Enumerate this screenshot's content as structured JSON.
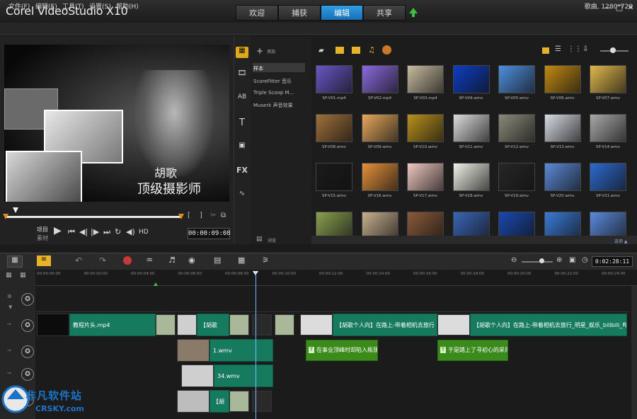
{
  "app": {
    "logo": "Corel VideoStudio X10"
  },
  "tabs": [
    {
      "label": "欢迎"
    },
    {
      "label": "捕获"
    },
    {
      "label": "编辑"
    },
    {
      "label": "共享"
    }
  ],
  "menu": {
    "items": [
      "文件(F)",
      "编辑(E)",
      "工具(T)",
      "设置(S)",
      "帮助(H)"
    ],
    "project_info": "歌曲, 1280*720"
  },
  "player": {
    "overlay_line1": "胡歌",
    "overlay_line2": "顶级摄影师",
    "mode_project": "项目",
    "mode_clip": "素材",
    "hd": "HD",
    "timecode": "00:00:09:08"
  },
  "library": {
    "add_label": "添加",
    "browse_label": "浏览",
    "folders": [
      "样本",
      "ScoreFitter 音乐",
      "Triple Scoop M...",
      "Muserk 声音效果"
    ],
    "thumbs": [
      {
        "label": "SP-V01.mp4",
        "color": "#6a56c8"
      },
      {
        "label": "SP-V02.mp4",
        "color": "#8a6adf"
      },
      {
        "label": "SP-V03.mp4",
        "color": "#c8bca0"
      },
      {
        "label": "SP-V04.wmv",
        "color": "#0c3ec4"
      },
      {
        "label": "SP-V05.wmv",
        "color": "#4f8fe0"
      },
      {
        "label": "SP-V06.wmv",
        "color": "#c28a14"
      },
      {
        "label": "SP-V07.wmv",
        "color": "#e2b84c"
      },
      {
        "label": "SP-V08.wmv",
        "color": "#a0703a"
      },
      {
        "label": "SP-V09.wmv",
        "color": "#e6a85c"
      },
      {
        "label": "SP-V10.wmv",
        "color": "#b8901c"
      },
      {
        "label": "SP-V11.wmv",
        "color": "#dcdcdc"
      },
      {
        "label": "SP-V12.wmv",
        "color": "#8a8a7a"
      },
      {
        "label": "SP-V13.wmv",
        "color": "#d8dce4"
      },
      {
        "label": "SP-V14.wmv",
        "color": "#a8a8a8"
      },
      {
        "label": "SP-V15.wmv",
        "color": "#1a1a1a"
      },
      {
        "label": "SP-V16.wmv",
        "color": "#e6903a"
      },
      {
        "label": "SP-V17.wmv",
        "color": "#f0c8c0"
      },
      {
        "label": "SP-V18.wmv",
        "color": "#f2f2ea"
      },
      {
        "label": "SP-V19.wmv",
        "color": "#262626"
      },
      {
        "label": "SP-V20.wmv",
        "color": "#5a8ad8"
      },
      {
        "label": "SP-V21.wmv",
        "color": "#2e6ad0"
      },
      {
        "label": "",
        "color": "#8aa050"
      },
      {
        "label": "",
        "color": "#c8b090"
      },
      {
        "label": "",
        "color": "#8a5a3a"
      },
      {
        "label": "",
        "color": "#3a66b8"
      },
      {
        "label": "",
        "color": "#1a48b0"
      },
      {
        "label": "",
        "color": "#3a7ad8"
      },
      {
        "label": "",
        "color": "#5a8adc"
      }
    ]
  },
  "timeline": {
    "timecode": "0:02:28:11",
    "ruler": [
      "00:00:00:00",
      "00:00:02:00",
      "00:00:04:00",
      "00:00:06:00",
      "00:00:08:00",
      "00:00:10:00",
      "00:00:12:00",
      "00:00:14:00",
      "00:00:16:00",
      "00:00:18:00",
      "00:00:20:00",
      "00:00:22:00",
      "00:00:24:00"
    ],
    "clips": {
      "video_main": "教程片头.mp4",
      "video_hu": "【胡歌",
      "video_long1": "【胡歌个人向】在路上-带着相机去旅行",
      "video_long2": "【胡歌个人向】在路上-带着相机去旅行_明星_娱乐_bilibili_哔",
      "overlay1": "1.wmv",
      "title1": "在事业顶峰时却陷入瓶颈",
      "title2": "于是踏上了寻初心的采风",
      "overlay2": "34.wmv",
      "music": "【胡"
    }
  },
  "watermark": {
    "big": "非凡软件站",
    "small": "CRSKY.com"
  }
}
